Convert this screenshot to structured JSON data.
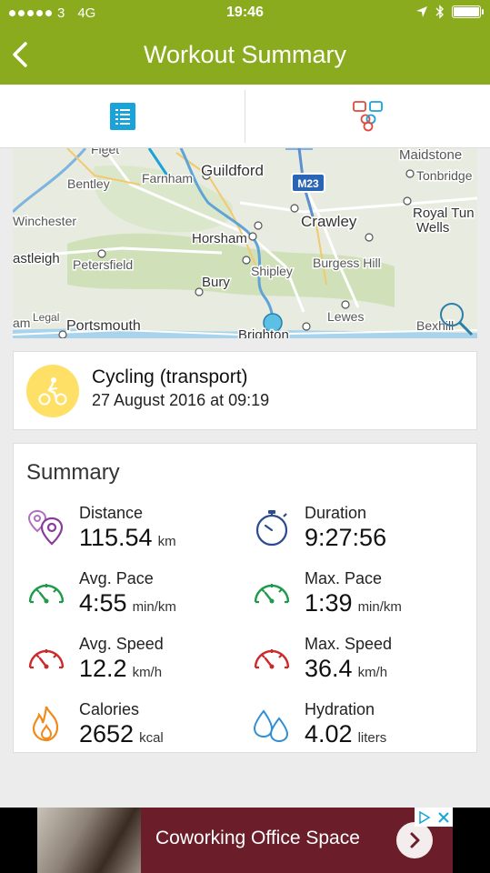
{
  "status_bar": {
    "carrier": "3",
    "network": "4G",
    "time": "19:46",
    "signal_dots": 5
  },
  "header": {
    "title": "Workout Summary"
  },
  "tabs": [
    {
      "name": "list-view",
      "icon": "list-icon"
    },
    {
      "name": "social",
      "icon": "chat-bubbles-icon"
    }
  ],
  "map": {
    "labels": [
      "Fleet",
      "Bentley",
      "Farnham",
      "Guildford",
      "Maidstone",
      "Tonbridge",
      "M23",
      "Winchester",
      "Crawley",
      "Royal Tun",
      "Wells",
      "Horsham",
      "astleigh",
      "Petersfield",
      "Bury",
      "Burgess Hill",
      "Shipley",
      "Legal",
      "Portsmouth",
      "Lewes",
      "Bexhill",
      "Brighton",
      "am"
    ]
  },
  "activity": {
    "name": "Cycling (transport)",
    "date": "27 August 2016 at 09:19"
  },
  "summary": {
    "title": "Summary",
    "metrics": [
      {
        "label": "Distance",
        "value": "115.54",
        "unit": "km"
      },
      {
        "label": "Duration",
        "value": "9:27:56",
        "unit": ""
      },
      {
        "label": "Avg. Pace",
        "value": "4:55",
        "unit": "min/km"
      },
      {
        "label": "Max. Pace",
        "value": "1:39",
        "unit": "min/km"
      },
      {
        "label": "Avg. Speed",
        "value": "12.2",
        "unit": "km/h"
      },
      {
        "label": "Max. Speed",
        "value": "36.4",
        "unit": "km/h"
      },
      {
        "label": "Calories",
        "value": "2652",
        "unit": "kcal"
      },
      {
        "label": "Hydration",
        "value": "4.02",
        "unit": "liters"
      }
    ]
  },
  "ad": {
    "text": "Coworking Office Space"
  },
  "colors": {
    "header": "#8bab1f",
    "accent_blue": "#1aa3d9",
    "pace_green": "#1e9a4a",
    "speed_red": "#cc2a2a",
    "distance_purple": "#8a3b9e",
    "duration_blue": "#2b4b8c",
    "calories_orange": "#f08a1c",
    "hydration_blue": "#2f8fd6",
    "activity_yellow": "#ffe066"
  }
}
